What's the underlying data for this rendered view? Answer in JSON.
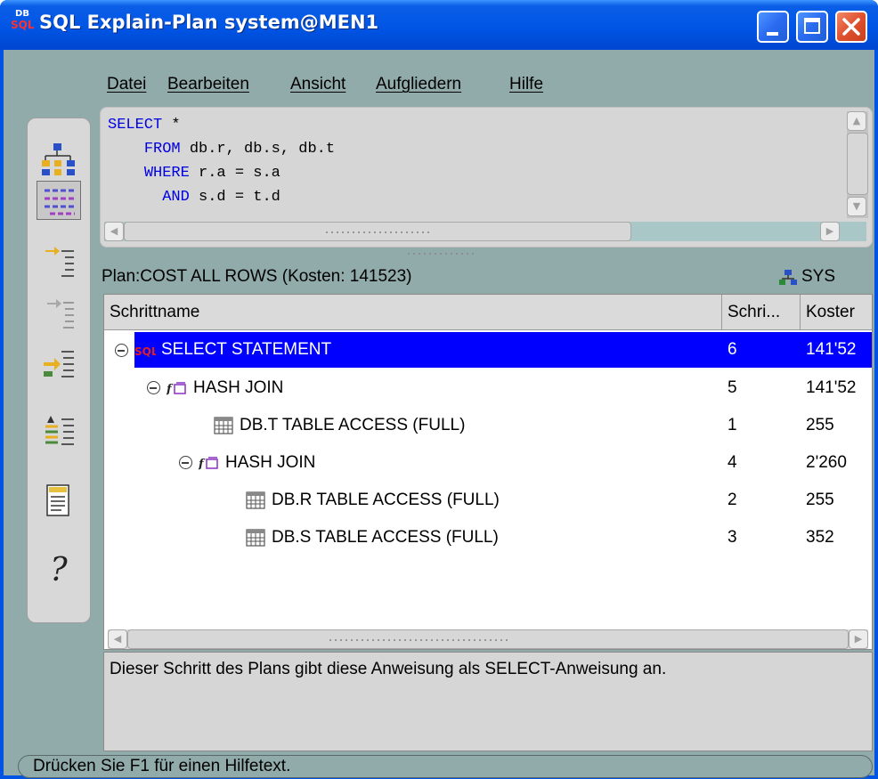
{
  "window": {
    "title": "SQL Explain-Plan system@MEN1",
    "icon_text_top": "DB",
    "icon_text_bottom": "SQL"
  },
  "menu": [
    {
      "label": "Datei"
    },
    {
      "label": "Bearbeiten"
    },
    {
      "label": "Ansicht"
    },
    {
      "label": "Aufgliedern"
    },
    {
      "label": "Hilfe"
    }
  ],
  "toolbar": {
    "tools": [
      "explain-tree-icon",
      "explain-list-icon",
      "expand-step-icon",
      "collapse-step-icon",
      "expand-all-icon",
      "details-icon",
      "report-icon",
      "help-icon"
    ],
    "help_glyph": "?"
  },
  "sql": {
    "lines": [
      {
        "kw": "SELECT",
        "rest": " *",
        "indent": ""
      },
      {
        "kw": "FROM",
        "rest": " db.r, db.s, db.t",
        "indent": "    "
      },
      {
        "kw": "WHERE",
        "rest": " r.a = s.a",
        "indent": "    "
      },
      {
        "kw": "AND",
        "rest": " s.d = t.d",
        "indent": "      "
      }
    ]
  },
  "plan": {
    "header": "Plan:COST ALL ROWS (Kosten: 141523)",
    "schema": "SYS",
    "columns": {
      "name": "Schrittname",
      "step": "Schri...",
      "cost": "Koster"
    },
    "rows": [
      {
        "name": "SELECT STATEMENT",
        "step": "6",
        "cost": "141'52",
        "level": 0,
        "icon": "sql-icon",
        "expandable": true,
        "selected": true
      },
      {
        "name": "HASH JOIN",
        "step": "5",
        "cost": "141'52",
        "level": 1,
        "icon": "function-icon",
        "expandable": true,
        "selected": false
      },
      {
        "name": "DB.T TABLE ACCESS (FULL)",
        "step": "1",
        "cost": "255",
        "level": 2,
        "icon": "table-icon",
        "expandable": false,
        "selected": false
      },
      {
        "name": "HASH JOIN",
        "step": "4",
        "cost": "2'260",
        "level": 2,
        "icon": "function-icon",
        "expandable": true,
        "selected": false
      },
      {
        "name": "DB.R TABLE ACCESS (FULL)",
        "step": "2",
        "cost": "255",
        "level": 3,
        "icon": "table-icon",
        "expandable": false,
        "selected": false
      },
      {
        "name": "DB.S TABLE ACCESS (FULL)",
        "step": "3",
        "cost": "352",
        "level": 3,
        "icon": "table-icon",
        "expandable": false,
        "selected": false
      }
    ]
  },
  "description": "Dieser Schritt des Plans gibt diese Anweisung als SELECT-Anweisung an.",
  "status": "Drücken Sie F1 für einen Hilfetext.",
  "colors": {
    "titlebar": "#0055e5",
    "client": "#91aaaa",
    "selection": "#0000ff",
    "keyword": "#0000e0"
  }
}
